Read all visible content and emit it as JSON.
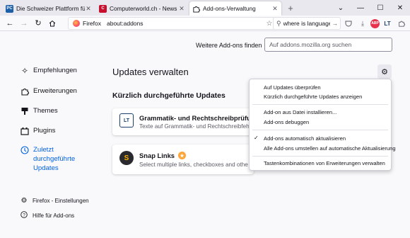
{
  "tabs": [
    {
      "label": "Die Schweizer Plattform für Co",
      "favicon": "PC",
      "favicon_color": "#1a5fa8"
    },
    {
      "label": "Computerworld.ch - News und",
      "favicon": "C",
      "favicon_color": "#c8102e"
    },
    {
      "label": "Add-ons-Verwaltung",
      "favicon": "puzzle-icon",
      "favicon_color": "#15141a"
    }
  ],
  "toolbar": {
    "identity": "Firefox",
    "url": "about:addons",
    "search_value": "where is language"
  },
  "extensions": {
    "abp_label": "ABP",
    "lt_label": "LT"
  },
  "sidebar": {
    "items": [
      {
        "label": "Empfehlungen"
      },
      {
        "label": "Erweiterungen"
      },
      {
        "label": "Themes"
      },
      {
        "label": "Plugins"
      },
      {
        "label": "Zuletzt durchgeführte Updates"
      }
    ],
    "footer": [
      {
        "label": "Firefox - Einstellungen"
      },
      {
        "label": "Hilfe für Add-ons"
      }
    ]
  },
  "main": {
    "find_more_label": "Weitere Add-ons finden",
    "find_more_placeholder": "Auf addons.mozilla.org suchen",
    "page_title": "Updates verwalten",
    "section_title": "Kürzlich durchgeführte Updates",
    "cards": [
      {
        "name": "Grammatik- und Rechtschreibprüfun",
        "description": "Texte auf Grammatik- und Rechtschreibfeh",
        "icon_text": "LT"
      },
      {
        "name": "Snap Links",
        "description": "Select multiple links, checkboxes and othe",
        "icon_text": "S"
      }
    ]
  },
  "menu": {
    "items": [
      {
        "label": "Auf Updates überprüfen",
        "checked": false
      },
      {
        "label": "Kürzlich durchgeführte Updates anzeigen",
        "checked": false
      },
      {
        "label": "Add-on aus Datei installieren...",
        "checked": false
      },
      {
        "label": "Add-ons debuggen",
        "checked": false
      },
      {
        "label": "Add-ons automatisch aktualisieren",
        "checked": true
      },
      {
        "label": "Alle Add-ons umstellen auf automatische Aktualisierung",
        "checked": false
      },
      {
        "label": "Tastenkombinationen von Erweiterungen verwalten",
        "checked": false
      }
    ]
  },
  "colors": {
    "accent": "#0061e0",
    "badge": "#ffa436"
  }
}
